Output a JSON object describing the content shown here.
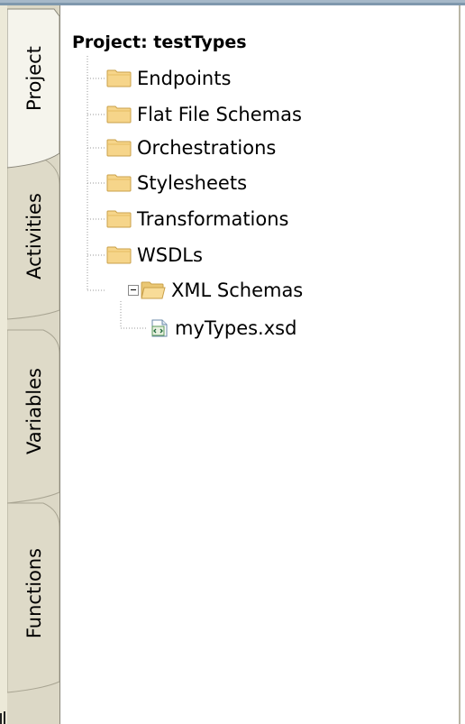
{
  "tabs": [
    {
      "label": "Project",
      "selected": true
    },
    {
      "label": "Activities",
      "selected": false
    },
    {
      "label": "Variables",
      "selected": false
    },
    {
      "label": "Functions",
      "selected": false
    }
  ],
  "tree": {
    "root_label": "Project: testTypes",
    "items": [
      {
        "label": "Endpoints",
        "icon": "folder-icon"
      },
      {
        "label": "Flat File Schemas",
        "icon": "folder-icon"
      },
      {
        "label": "Orchestrations",
        "icon": "folder-icon"
      },
      {
        "label": "Stylesheets",
        "icon": "folder-icon"
      },
      {
        "label": "Transformations",
        "icon": "folder-icon"
      },
      {
        "label": "WSDLs",
        "icon": "folder-icon"
      },
      {
        "label": "XML Schemas",
        "icon": "open-folder-icon",
        "expanded": true,
        "children": [
          {
            "label": "myTypes.xsd",
            "icon": "xsd-file-icon"
          }
        ]
      }
    ]
  },
  "colors": {
    "tab_bg": "#dcd8c6",
    "tab_selected": "#f5f4ec",
    "folder_fill": "#f6d58a",
    "folder_edge": "#c9a04a",
    "tree_line": "#a0a0a0"
  }
}
